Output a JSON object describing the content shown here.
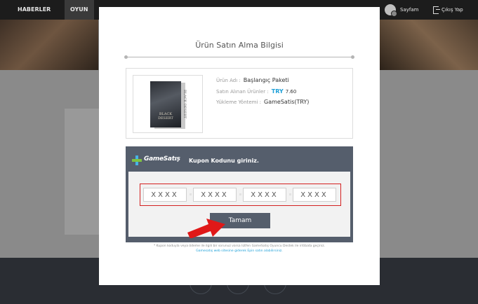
{
  "nav": {
    "items": [
      {
        "label": "HABERLER"
      },
      {
        "label": "OYUN"
      }
    ],
    "profile_label": "Sayfam",
    "logout_label": "Çıkış Yap"
  },
  "modal": {
    "title": "Ürün Satın Alma Bilgisi",
    "product": {
      "box_title": "BLACK DESERT",
      "name_label": "Ürün Adı :",
      "name_value": "Başlangıç Paketi",
      "price_label": "Satın Alınan Ürünler :",
      "price_currency": "TRY",
      "price_value": "7.60",
      "method_label": "Yükleme Yöntemi :",
      "method_value": "GameSatis(TRY)"
    },
    "coupon": {
      "logo_text": "GameSatış",
      "heading": "Kupon Kodunu giriniz.",
      "inputs": [
        {
          "placeholder": "XXXX"
        },
        {
          "placeholder": "XXXX"
        },
        {
          "placeholder": "XXXX"
        },
        {
          "placeholder": "XXXX"
        }
      ],
      "submit_label": "Tamam"
    },
    "note_line1": "* Kupon koduyla veya ödeme ile ilgili bir sorunuz varsa lütfen GameSatış Oyuncu Destek ile iritibata geçiniz.",
    "note_line2": "Gamesatış web sitesine giderek Epin satın alabilirsiniz."
  },
  "colors": {
    "accent_blue": "#1fa0d8",
    "panel_slate": "#555e6c",
    "highlight_red": "#d42020",
    "overlay_gray": "#7a7a7a"
  }
}
